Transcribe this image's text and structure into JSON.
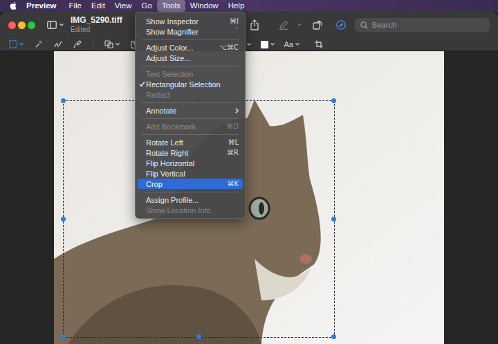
{
  "menubar": {
    "items": [
      {
        "label": "Preview",
        "kind": "app",
        "selected": false
      },
      {
        "label": "File",
        "kind": "menu",
        "selected": false
      },
      {
        "label": "Edit",
        "kind": "menu",
        "selected": false
      },
      {
        "label": "View",
        "kind": "menu",
        "selected": false
      },
      {
        "label": "Go",
        "kind": "menu",
        "selected": false
      },
      {
        "label": "Tools",
        "kind": "menu",
        "selected": true
      },
      {
        "label": "Window",
        "kind": "menu",
        "selected": false
      },
      {
        "label": "Help",
        "kind": "menu",
        "selected": false
      }
    ]
  },
  "window": {
    "title": "IMG_5290.tiff",
    "subtitle": "Edited"
  },
  "search": {
    "placeholder": "Search"
  },
  "markup_toolbar": {
    "font_button": "Aa"
  },
  "menu": {
    "title": "Tools",
    "groups": [
      [
        {
          "label": "Show Inspector",
          "shortcut": "⌘I",
          "disabled": false,
          "checked": false,
          "selected": false,
          "submenu": false
        },
        {
          "label": "Show Magnifier",
          "shortcut": "`",
          "disabled": false,
          "checked": false,
          "selected": false,
          "submenu": false
        }
      ],
      [
        {
          "label": "Adjust Color...",
          "shortcut": "⌥⌘C",
          "disabled": false,
          "checked": false,
          "selected": false,
          "submenu": false
        },
        {
          "label": "Adjust Size...",
          "shortcut": "",
          "disabled": false,
          "checked": false,
          "selected": false,
          "submenu": false
        }
      ],
      [
        {
          "label": "Text Selection",
          "shortcut": "",
          "disabled": true,
          "checked": false,
          "selected": false,
          "submenu": false
        },
        {
          "label": "Rectangular Selection",
          "shortcut": "",
          "disabled": false,
          "checked": true,
          "selected": false,
          "submenu": false
        },
        {
          "label": "Redact",
          "shortcut": "",
          "disabled": true,
          "checked": false,
          "selected": false,
          "submenu": false
        }
      ],
      [
        {
          "label": "Annotate",
          "shortcut": "",
          "disabled": false,
          "checked": false,
          "selected": false,
          "submenu": true
        }
      ],
      [
        {
          "label": "Add Bookmark",
          "shortcut": "⌘D",
          "disabled": true,
          "checked": false,
          "selected": false,
          "submenu": false
        }
      ],
      [
        {
          "label": "Rotate Left",
          "shortcut": "⌘L",
          "disabled": false,
          "checked": false,
          "selected": false,
          "submenu": false
        },
        {
          "label": "Rotate Right",
          "shortcut": "⌘R",
          "disabled": false,
          "checked": false,
          "selected": false,
          "submenu": false
        },
        {
          "label": "Flip Horizontal",
          "shortcut": "",
          "disabled": false,
          "checked": false,
          "selected": false,
          "submenu": false
        },
        {
          "label": "Flip Vertical",
          "shortcut": "",
          "disabled": false,
          "checked": false,
          "selected": false,
          "submenu": false
        },
        {
          "label": "Crop",
          "shortcut": "⌘K",
          "disabled": false,
          "checked": false,
          "selected": true,
          "submenu": false
        }
      ],
      [
        {
          "label": "Assign Profile...",
          "shortcut": "",
          "disabled": false,
          "checked": false,
          "selected": false,
          "submenu": false
        },
        {
          "label": "Show Location Info",
          "shortcut": "",
          "disabled": true,
          "checked": false,
          "selected": false,
          "submenu": false
        }
      ]
    ]
  }
}
